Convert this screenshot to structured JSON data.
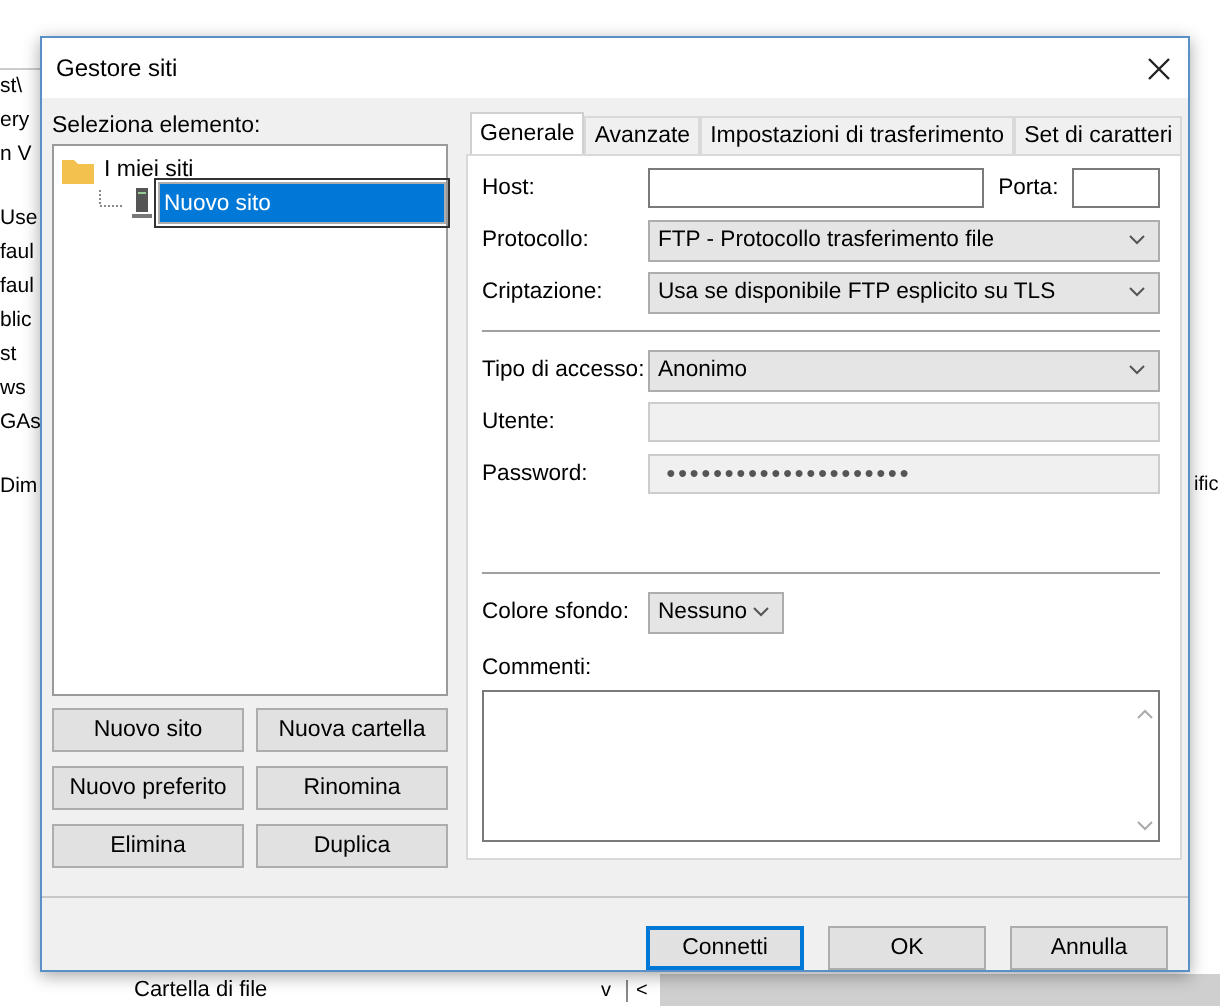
{
  "background": {
    "left_fragments": [
      [
        "st\\",
        "ery",
        "n V"
      ],
      [
        "Use",
        "faul",
        "faul",
        "blic",
        "st",
        "ws",
        "GAs"
      ]
    ],
    "header_left": "Dim",
    "header_right": "ific",
    "bottom_label": "Cartella di file",
    "bottom_symbols": [
      "v",
      "<"
    ]
  },
  "dialog": {
    "title": "Gestore siti",
    "tree_label": "Seleziona elemento:",
    "tree": [
      {
        "label": "I miei siti",
        "kind": "folder",
        "expanded": true,
        "children": [
          {
            "label": "Nuovo sito",
            "kind": "site",
            "selected": true
          }
        ]
      }
    ],
    "tree_buttons": [
      "Nuovo sito",
      "Nuova cartella",
      "Nuovo preferito",
      "Rinomina",
      "Elimina",
      "Duplica"
    ],
    "tabs": [
      {
        "label": "Generale",
        "selected": true
      },
      {
        "label": "Avanzate",
        "selected": false
      },
      {
        "label": "Impostazioni di trasferimento",
        "selected": false
      },
      {
        "label": "Set di caratteri",
        "selected": false
      }
    ],
    "sections": [
      [
        {
          "label": "Host:",
          "kind": "text",
          "extra": {
            "label": "Porta:",
            "kind": "text"
          }
        },
        {
          "label": "Protocollo:",
          "kind": "select",
          "value": "FTP - Protocollo trasferimento file"
        },
        {
          "label": "Criptazione:",
          "kind": "select",
          "value": "Usa se disponibile FTP esplicito su TLS"
        }
      ],
      [
        {
          "label": "Tipo di accesso:",
          "kind": "select",
          "value": "Anonimo"
        },
        {
          "label": "Utente:",
          "kind": "disabled"
        },
        {
          "label": "Password:",
          "kind": "disabled",
          "value": "●●●●●●●●●●●●●●●●●●●●●"
        }
      ],
      [
        {
          "label": "Colore sfondo:",
          "kind": "small-select",
          "value": "Nessuno"
        },
        {
          "label": "Commenti:",
          "kind": "textarea"
        }
      ]
    ],
    "buttons": [
      {
        "label": "Connetti",
        "default": true
      },
      {
        "label": "OK",
        "default": false
      },
      {
        "label": "Annulla",
        "default": false
      }
    ]
  }
}
